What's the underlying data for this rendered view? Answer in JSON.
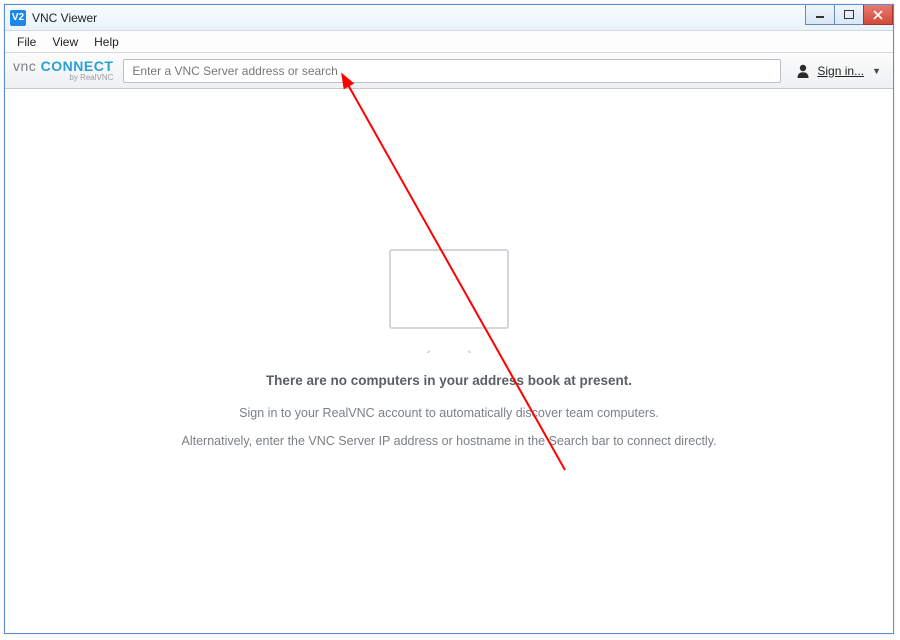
{
  "titlebar": {
    "app_icon_text": "V2",
    "title": "VNC Viewer"
  },
  "menu": {
    "items": [
      "File",
      "View",
      "Help"
    ]
  },
  "toolbar": {
    "brand_vnc": "vnc",
    "brand_connect": " CONNECT",
    "brand_sub": "by RealVNC",
    "search_placeholder": "Enter a VNC Server address or search",
    "signin_label": "Sign in..."
  },
  "content": {
    "title": "There are no computers in your address book at present.",
    "line1": "Sign in to your RealVNC account to automatically discover team computers.",
    "line2": "Alternatively, enter the VNC Server IP address or hostname in the Search bar to connect directly."
  }
}
